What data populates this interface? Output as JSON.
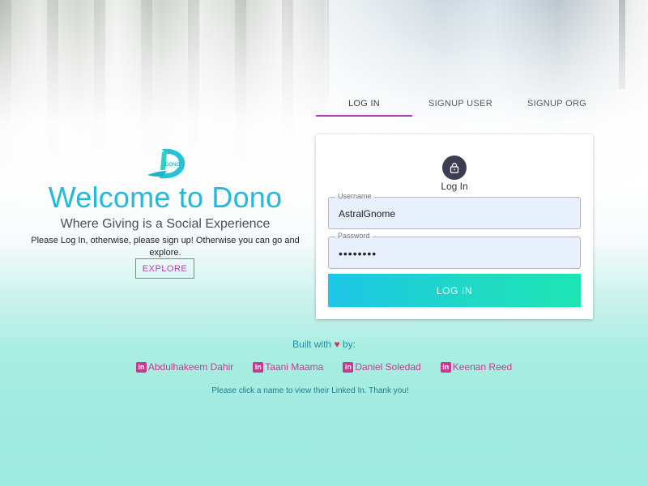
{
  "hero": {
    "title": "Welcome to Dono",
    "tagline": "Where Giving is a Social Experience",
    "subtext": "Please Log In, otherwise, please sign up! Otherwise you can go and explore.",
    "explore_label": "EXPLORE",
    "logo_text": "DONO"
  },
  "tabs": [
    {
      "label": "LOG IN",
      "active": true
    },
    {
      "label": "SIGNUP USER",
      "active": false
    },
    {
      "label": "SIGNUP ORG",
      "active": false
    }
  ],
  "login_form": {
    "title": "Log In",
    "username_label": "Username",
    "username_value": "AstralGnome",
    "password_label": "Password",
    "password_value": "••••••••",
    "submit_label": "LOG IN"
  },
  "footer": {
    "built_prefix": "Built with",
    "heart": "♥",
    "built_suffix": "by:",
    "credits": [
      {
        "name": "Abdulhakeem Dahir",
        "icon": "linkedin-icon"
      },
      {
        "name": "Taani Maama",
        "icon": "linkedin-icon"
      },
      {
        "name": "Daniel Soledad",
        "icon": "linkedin-icon"
      },
      {
        "name": "Keenan Reed",
        "icon": "linkedin-icon"
      }
    ],
    "note": "Please click a name to view their Linked In. Thank you!"
  },
  "colors": {
    "accent_purple": "#b43fbd",
    "title_blue": "#25b9dc",
    "credit_pink": "#c53a8f",
    "button_gradient_start": "#1ec6e8",
    "button_gradient_end": "#1ee5b4"
  }
}
